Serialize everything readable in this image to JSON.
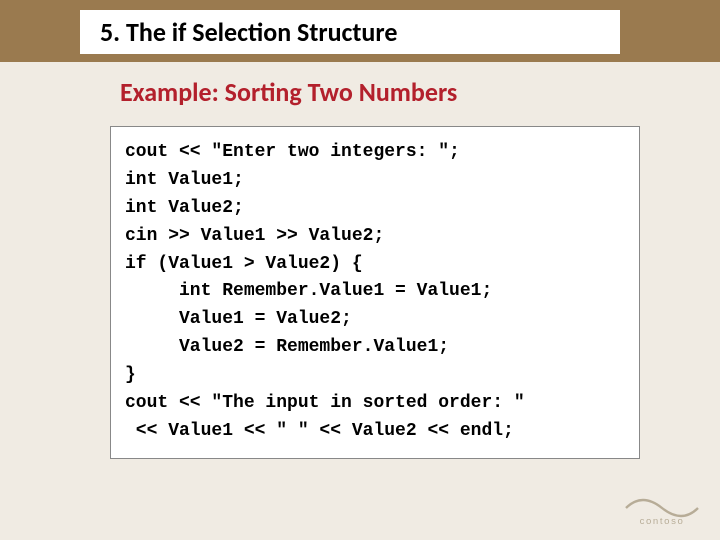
{
  "header": {
    "title": "5.  The if Selection Structure"
  },
  "subtitle": "Example: Sorting Two Numbers",
  "code": "cout << \"Enter two integers: \";\nint Value1;\nint Value2;\ncin >> Value1 >> Value2;\nif (Value1 > Value2) {\n     int Remember.Value1 = Value1;\n     Value1 = Value2;\n     Value2 = Remember.Value1;\n}\ncout << \"The input in sorted order: \"\n << Value1 << \" \" << Value2 << endl;",
  "logo_text": "contoso"
}
